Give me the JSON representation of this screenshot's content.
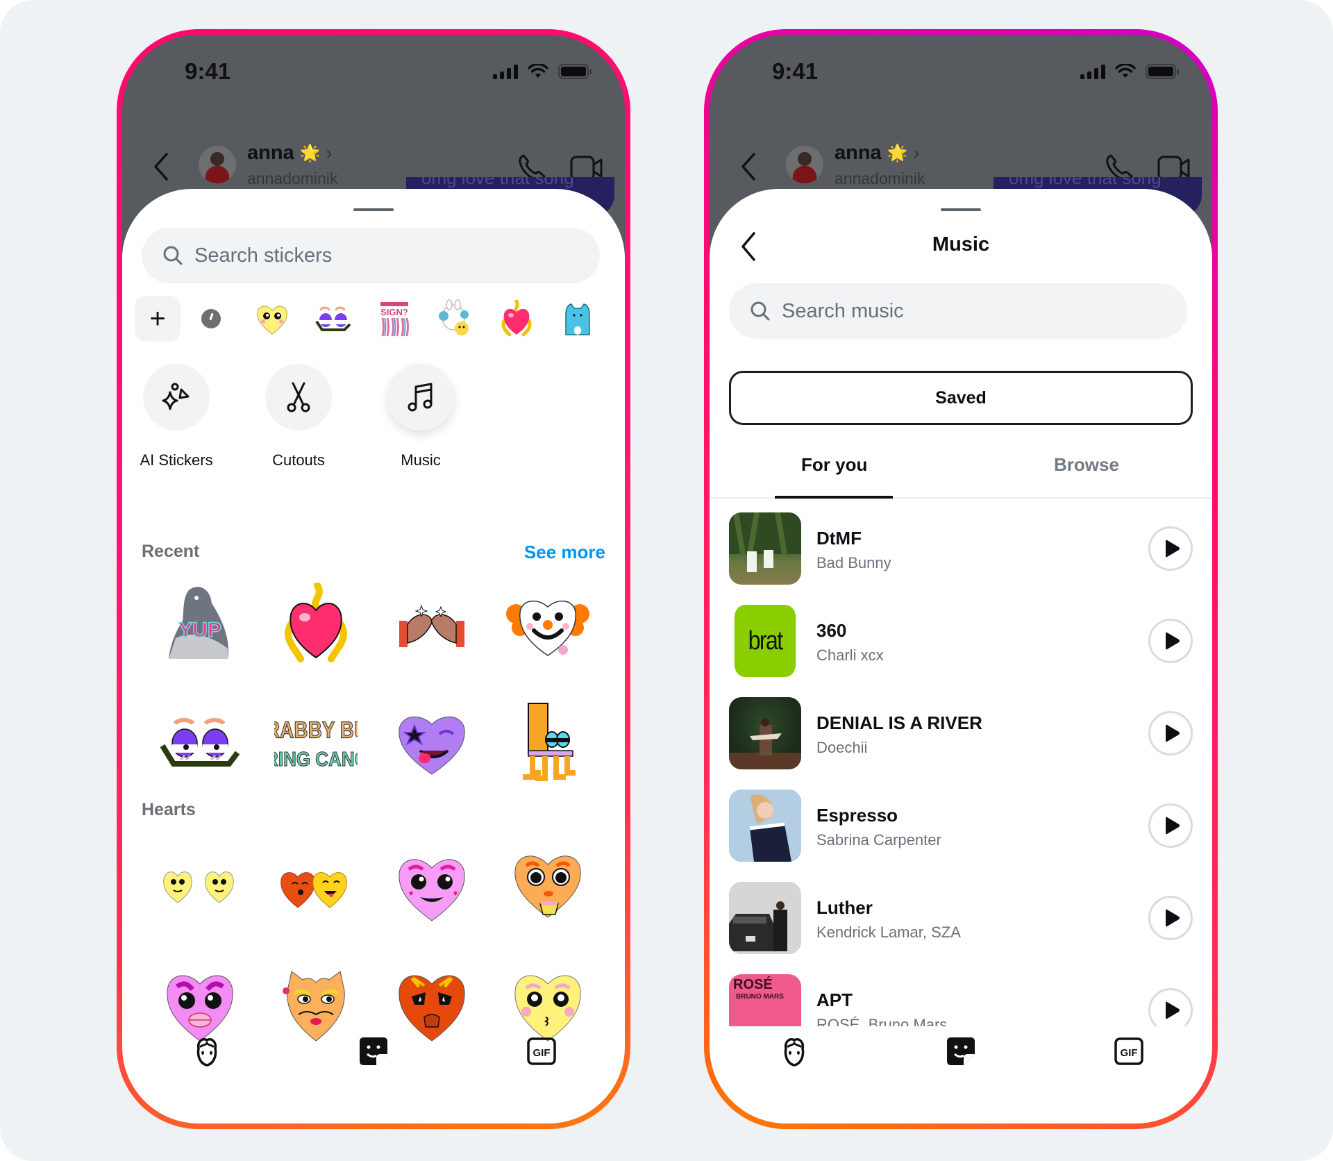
{
  "status_bar": {
    "time": "9:41"
  },
  "chat_header": {
    "name": "anna",
    "name_badge": "🌟",
    "chevron": "›",
    "handle": "annadominik",
    "bubble_text": "omg love that song"
  },
  "sticker_sheet": {
    "search_placeholder": "Search stickers",
    "tray": {
      "add_label": "+",
      "items": [
        "recent-icon",
        "yellow-heart-face",
        "purple-eyes",
        "whats-your-sign",
        "bunny-chick",
        "flaming-heart",
        "blue-cat"
      ]
    },
    "categories": [
      {
        "label": "AI Stickers",
        "icon": "ai-sparkle-icon"
      },
      {
        "label": "Cutouts",
        "icon": "scissors-icon"
      },
      {
        "label": "Music",
        "icon": "music-note-icon",
        "active": true
      }
    ],
    "recent": {
      "title": "Recent",
      "see_more": "See more",
      "stickers": [
        "pigeon-yup",
        "flaming-heart",
        "pinky-promise-hands",
        "clown-heart",
        "purple-eyes",
        "crabby-but-caring-cancer",
        "winking-purple-heart",
        "orange-chair-creature"
      ],
      "yup_text": "YUP",
      "crabby_text": [
        "CRABBY BUT",
        "CARING CANCER"
      ]
    },
    "hearts": {
      "title": "Hearts",
      "stickers": [
        "twin-yellow-hearts",
        "orange-yellow-heart-duo",
        "pink-smiling-heart",
        "orange-tea-heart",
        "pink-kiss-heart",
        "orange-mustache-heart",
        "red-angry-heart",
        "yellow-cute-heart"
      ]
    }
  },
  "music_sheet": {
    "title": "Music",
    "search_placeholder": "Search music",
    "saved_label": "Saved",
    "tabs": [
      {
        "label": "For you",
        "active": true
      },
      {
        "label": "Browse",
        "active": false
      }
    ],
    "songs": [
      {
        "title": "DtMF",
        "artist": "Bad Bunny",
        "art": "dtmf"
      },
      {
        "title": "360",
        "artist": "Charli xcx",
        "art": "brat",
        "art_text": "brat"
      },
      {
        "title": "DENIAL IS A RIVER",
        "artist": "Doechii",
        "art": "denial"
      },
      {
        "title": "Espresso",
        "artist": "Sabrina Carpenter",
        "art": "espresso"
      },
      {
        "title": "Luther",
        "artist": "Kendrick Lamar, SZA",
        "art": "luther"
      },
      {
        "title": "APT",
        "artist": "ROSÉ, Bruno Mars",
        "art": "apt",
        "art_text": "ROSÉ",
        "art_subtext": "BRUNO MARS"
      }
    ]
  },
  "bottom_tabs": [
    {
      "icon": "avatar-face-icon"
    },
    {
      "icon": "sticker-icon",
      "active": true
    },
    {
      "icon": "gif-icon",
      "label": "GIF"
    }
  ]
}
